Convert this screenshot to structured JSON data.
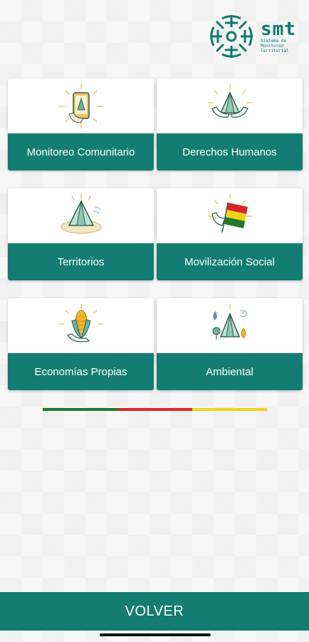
{
  "header": {
    "logo_title": "smt",
    "logo_subtitle": "Sistema de Monitoreo Territorial"
  },
  "categories": [
    {
      "label": "Monitoreo Comunitario",
      "icon": "phone-monitoring-icon"
    },
    {
      "label": "Derechos Humanos",
      "icon": "hands-hut-icon"
    },
    {
      "label": "Territorios",
      "icon": "hut-landscape-icon"
    },
    {
      "label": "Movilización Social",
      "icon": "fist-flag-icon"
    },
    {
      "label": "Economías Propias",
      "icon": "corn-icon"
    },
    {
      "label": "Ambiental",
      "icon": "environment-icon"
    }
  ],
  "flag_colors": [
    "#1f7a2c",
    "#d62828",
    "#f2d21b"
  ],
  "footer": {
    "volver_label": "VOLVER"
  },
  "colors": {
    "accent": "#137d73"
  }
}
